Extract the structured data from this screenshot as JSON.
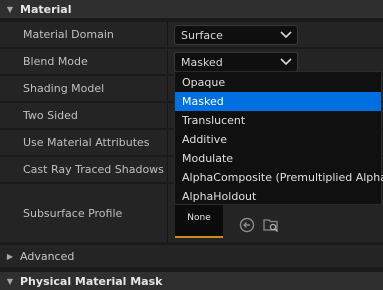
{
  "material_section": {
    "title": "Material"
  },
  "properties": [
    {
      "label": "Material Domain"
    },
    {
      "label": "Blend Mode"
    },
    {
      "label": "Shading Model"
    },
    {
      "label": "Two Sided"
    },
    {
      "label": "Use Material Attributes"
    },
    {
      "label": "Cast Ray Traced Shadows"
    },
    {
      "label": "Subsurface Profile"
    }
  ],
  "material_domain": {
    "value": "Surface"
  },
  "blend_mode": {
    "value": "Masked",
    "options": [
      "Opaque",
      "Masked",
      "Translucent",
      "Additive",
      "Modulate",
      "AlphaComposite (Premultiplied Alpha)",
      "AlphaHoldout"
    ],
    "selected_index": 1
  },
  "subsurface_profile": {
    "value": "None"
  },
  "advanced_section": {
    "title": "Advanced"
  },
  "physical_material_mask_section": {
    "title": "Physical Material Mask"
  },
  "colors": {
    "selection": "#0070e0",
    "asset_accent": "#d38a14"
  }
}
